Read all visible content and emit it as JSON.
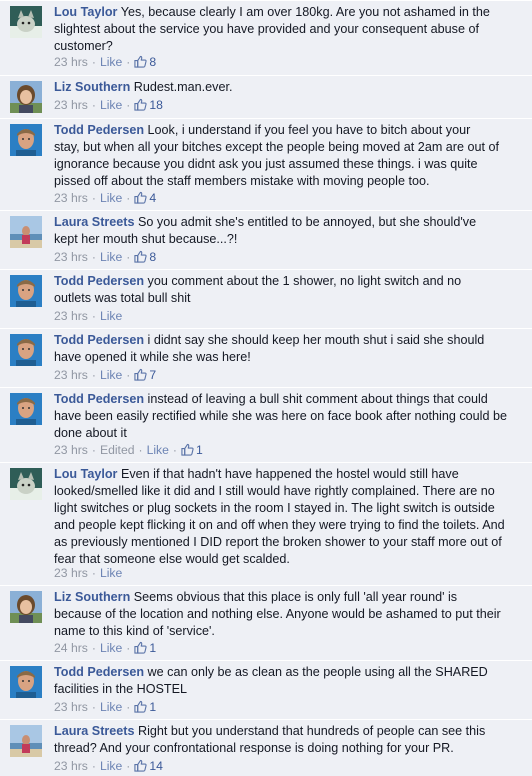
{
  "ui": {
    "like_label": "Like",
    "edited_label": "Edited"
  },
  "comments": [
    {
      "author": "Lou Taylor",
      "text": "Yes, because clearly I am over 180kg. Are you not ashamed in the\nslightest about the service you have provided and your consequent abuse of\ncustomer?",
      "time": "23 hrs",
      "likes": "8",
      "avatar": "avatar-cat"
    },
    {
      "author": "Liz Southern",
      "text": "Rudest.man.ever.",
      "time": "23 hrs",
      "likes": "18",
      "avatar": "avatar-woman-outdoor"
    },
    {
      "author": "Todd Pedersen",
      "text": "Look, i understand if you feel you have to bitch about your\nstay, but when all your bitches except the people being moved at 2am are out of\nignorance because you didnt ask you just assumed these things. i was quite\npissed off about the staff members mistake with moving people too.",
      "time": "23 hrs",
      "likes": "4",
      "avatar": "avatar-man-blue"
    },
    {
      "author": "Laura Streets",
      "text": "So you admit she's entitled to be annoyed, but she should've\nkept her mouth shut because...?!",
      "time": "23 hrs",
      "likes": "8",
      "avatar": "avatar-beach"
    },
    {
      "author": "Todd Pedersen",
      "text": "you comment about the 1 shower, no light switch and no\noutlets was total bull shit",
      "time": "23 hrs",
      "likes": "",
      "avatar": "avatar-man-blue"
    },
    {
      "author": "Todd Pedersen",
      "text": "i didnt say she should keep her mouth shut i said she should\nhave opened it while she was here!",
      "time": "23 hrs",
      "likes": "7",
      "avatar": "avatar-man-blue"
    },
    {
      "author": "Todd Pedersen",
      "text": "instead of leaving a bull shit comment about things that could\nhave been easily rectified while she was here on face book after nothing could be\ndone about it",
      "time": "23 hrs",
      "edited": true,
      "likes": "1",
      "avatar": "avatar-man-blue"
    },
    {
      "author": "Lou Taylor",
      "text": "Even if that hadn't have happened the hostel would still have\nlooked/smelled like it did and I still would have rightly complained. There are no\nlight switches or plug sockets in the room I stayed in. The light switch is outside\nand people kept flicking it on and off when they were trying to find the toilets. And\nas previously mentioned I DID report the broken shower to your staff more out of\nfear that someone else would get scalded.",
      "time": "23 hrs",
      "likes": "",
      "avatar": "avatar-cat"
    },
    {
      "author": "Liz Southern",
      "text": "Seems obvious that this place is only full 'all year round' is\nbecause of the location and nothing else. Anyone would be ashamed to put their\nname to this kind of 'service'.",
      "time": "24 hrs",
      "likes": "1",
      "avatar": "avatar-woman-outdoor"
    },
    {
      "author": "Todd Pedersen",
      "text": "we can only be as clean as the people using all the SHARED\nfacilities in the HOSTEL",
      "time": "23 hrs",
      "likes": "1",
      "avatar": "avatar-man-blue"
    },
    {
      "author": "Laura Streets",
      "text": "Right but you understand that hundreds of people can see this\nthread? And your confrontational response is doing nothing for your PR.",
      "time": "23 hrs",
      "likes": "14",
      "avatar": "avatar-beach"
    }
  ]
}
